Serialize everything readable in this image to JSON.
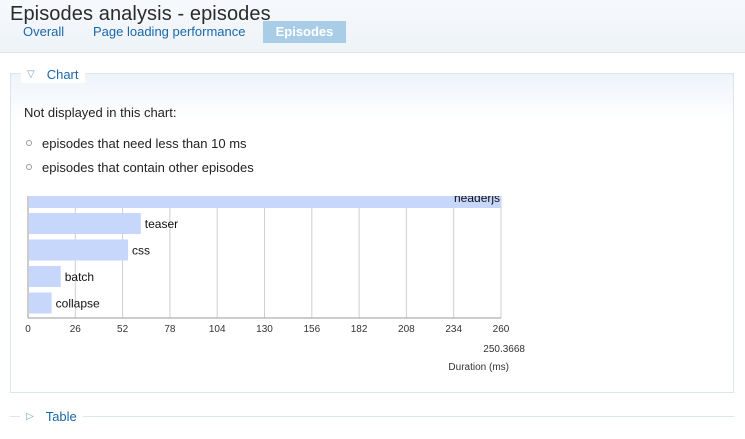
{
  "page": {
    "title": "Episodes analysis - episodes",
    "tabs": [
      {
        "label": "Overall",
        "active": false
      },
      {
        "label": "Page loading performance",
        "active": false
      },
      {
        "label": "Episodes",
        "active": true
      }
    ]
  },
  "chart_section": {
    "legend": "Chart",
    "expanded": true,
    "note": "Not displayed in this chart:",
    "exclusions": [
      "episodes that need less than 10 ms",
      "episodes that contain other episodes"
    ]
  },
  "table_section": {
    "legend": "Table",
    "expanded": false
  },
  "colors": {
    "bar": "#c6d7fb",
    "link": "#1a67a8",
    "active_tab": "#a9cde6"
  },
  "chart_data": {
    "type": "bar",
    "orientation": "horizontal",
    "categories": [
      "headerjs",
      "teaser",
      "css",
      "batch",
      "collapse"
    ],
    "values": [
      260,
      62,
      55,
      18,
      13
    ],
    "xlim": [
      0,
      260
    ],
    "xticks": [
      "0",
      "26",
      "52",
      "78",
      "104",
      "130",
      "156",
      "182",
      "208",
      "234",
      "260"
    ],
    "max_value_label": "250.3668",
    "xlabel": "Duration (ms)",
    "grid": true
  }
}
